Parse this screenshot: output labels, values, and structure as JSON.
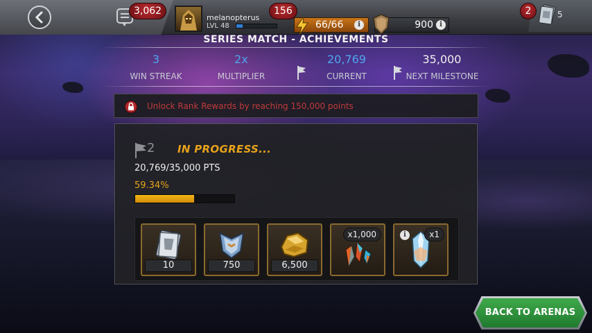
{
  "topbar": {
    "chat_count": "3,062",
    "player": {
      "name": "melanopterus",
      "level": "LVL 48",
      "xp_fraction": 0.15,
      "notification_count": "156"
    },
    "energy": "66/66",
    "gold": "900",
    "cards": {
      "badge": "2",
      "count": "5"
    }
  },
  "header": {
    "title": "SERIES MATCH - ACHIEVEMENTS",
    "stats": [
      {
        "value": "3",
        "label": "WIN STREAK"
      },
      {
        "value": "2x",
        "label": "MULTIPLIER"
      },
      {
        "value": "20,769",
        "label": "CURRENT"
      },
      {
        "value": "35,000",
        "label": "NEXT MILESTONE"
      }
    ]
  },
  "rank_banner": {
    "text": "Unlock Rank Rewards by reaching 150,000 points"
  },
  "milestone": {
    "number": "2",
    "status": "IN PROGRESS...",
    "points": "20,769/35,000 PTS",
    "percent_text": "59.34%",
    "progress_fraction": 0.5934
  },
  "rewards": [
    {
      "name": "silver-card-icon",
      "amount": "10"
    },
    {
      "name": "chevron-badge-icon",
      "amount": "750"
    },
    {
      "name": "gold-nugget-icon",
      "amount": "6,500"
    },
    {
      "name": "crystal-shards-icon",
      "multiplier": "x1,000"
    },
    {
      "name": "crystal-icon",
      "multiplier": "x1"
    }
  ],
  "buttons": {
    "back_to_arenas": "BACK TO ARENAS"
  },
  "colors": {
    "accent_gold": "#e6a21a",
    "stat_blue": "#4ea6ee",
    "warning_red": "#c13a3a",
    "button_green": "#2f913b"
  }
}
